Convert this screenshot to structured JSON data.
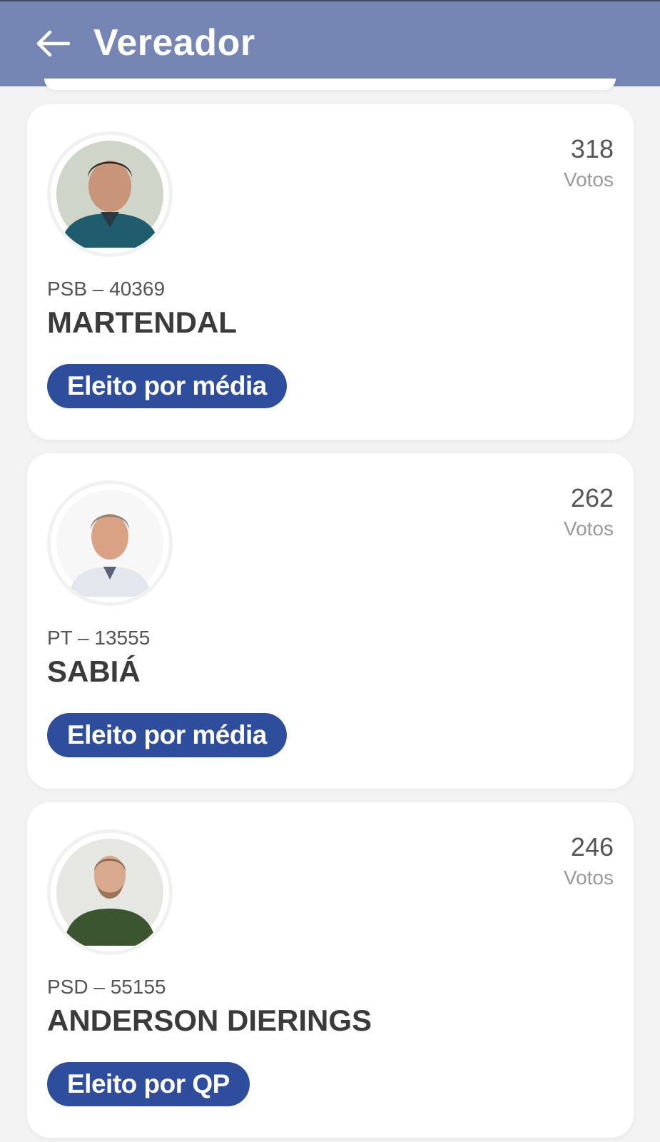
{
  "header": {
    "title": "Vereador",
    "back_icon": "arrow-left-icon"
  },
  "colors": {
    "header_bg": "#7586b4",
    "badge_bg": "#2e4d9c",
    "page_bg": "#f3f3f3"
  },
  "candidates": [
    {
      "party_number": "PSB – 40369",
      "name": "MARTENDAL",
      "votes": "318",
      "votes_label": "Votos",
      "status": "Eleito por média"
    },
    {
      "party_number": "PT – 13555",
      "name": "SABIÁ",
      "votes": "262",
      "votes_label": "Votos",
      "status": "Eleito por média"
    },
    {
      "party_number": "PSD – 55155",
      "name": "ANDERSON DIERINGS",
      "votes": "246",
      "votes_label": "Votos",
      "status": "Eleito por QP"
    }
  ]
}
